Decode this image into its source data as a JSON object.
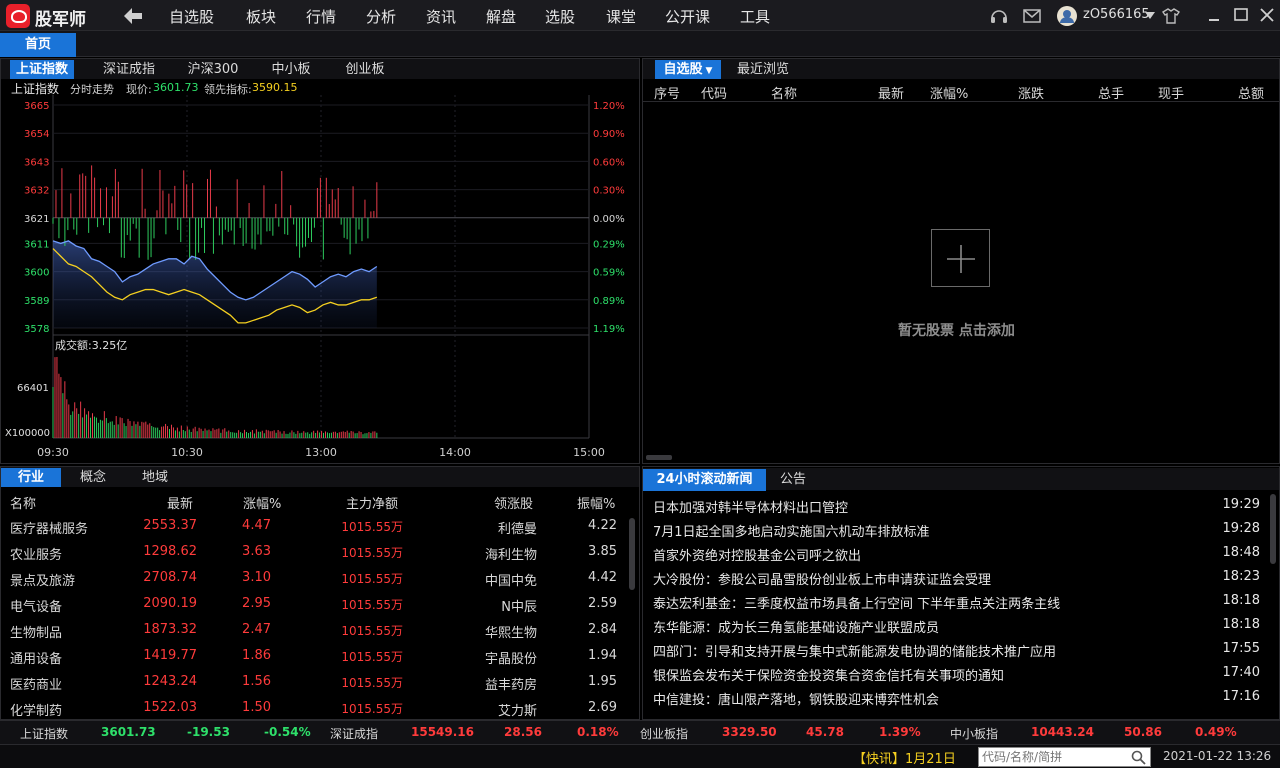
{
  "app": {
    "name": "股军师",
    "menu": [
      "自选股",
      "板块",
      "行情",
      "分析",
      "资讯",
      "解盘",
      "选股",
      "课堂",
      "公开课",
      "工具"
    ],
    "user": "zO566165",
    "home_tab": "首页"
  },
  "index_panel": {
    "tabs": [
      "上证指数",
      "深证成指",
      "沪深300",
      "中小板",
      "创业板"
    ],
    "header": {
      "name": "上证指数",
      "mode": "分时走势",
      "price_label": "现价:",
      "price": "3601.73",
      "lead_label": "领先指标:",
      "lead": "3590.15"
    },
    "volume_label": "成交额:3.25亿",
    "volume_ticks": [
      "66401",
      "X100000"
    ]
  },
  "chart_data": {
    "type": "line",
    "title": "",
    "y_ticks": [
      "3665",
      "3654",
      "3643",
      "3632",
      "3621",
      "3611",
      "3600",
      "3589",
      "3578"
    ],
    "pct_ticks": [
      "1.20%",
      "0.90%",
      "0.60%",
      "0.30%",
      "0.00%",
      "0.29%",
      "0.59%",
      "0.89%",
      "1.19%"
    ],
    "x_ticks": [
      "09:30",
      "10:30",
      "13:00",
      "14:00",
      "15:00"
    ],
    "ylim": [
      3578,
      3665
    ],
    "prev_close": 3621,
    "series": [
      {
        "values": [
          3612,
          3611,
          3612,
          3610,
          3609,
          3605,
          3604,
          3602,
          3600,
          3596,
          3598,
          3599,
          3601,
          3603,
          3604,
          3605,
          3605,
          3603,
          3606,
          3605,
          3601,
          3598,
          3595,
          3592,
          3590,
          3589,
          3590,
          3592,
          3594,
          3596,
          3598,
          3600,
          3599,
          3597,
          3594,
          3596,
          3598,
          3599,
          3598,
          3600,
          3601,
          3600,
          3602
        ]
      },
      {
        "values": [
          3609,
          3606,
          3603,
          3602,
          3600,
          3598,
          3595,
          3592,
          3590,
          3589,
          3591,
          3592,
          3593,
          3593,
          3592,
          3591,
          3592,
          3593,
          3592,
          3591,
          3589,
          3587,
          3585,
          3583,
          3580,
          3580,
          3581,
          3582,
          3583,
          3585,
          3586,
          3587,
          3586,
          3584,
          3585,
          3587,
          3588,
          3587,
          3587,
          3588,
          3589,
          3589,
          3590
        ]
      }
    ]
  },
  "sector_panel": {
    "tabs": [
      "行业",
      "概念",
      "地域"
    ],
    "columns": [
      "名称",
      "最新",
      "涨幅%",
      "主力净额",
      "领涨股",
      "振幅%"
    ],
    "rows": [
      [
        "医疗器械服务",
        "2553.37",
        "4.47",
        "1015.55万",
        "利德曼",
        "4.22"
      ],
      [
        "农业服务",
        "1298.62",
        "3.63",
        "1015.55万",
        "海利生物",
        "3.85"
      ],
      [
        "景点及旅游",
        "2708.74",
        "3.10",
        "1015.55万",
        "中国中免",
        "4.42"
      ],
      [
        "电气设备",
        "2090.19",
        "2.95",
        "1015.55万",
        "N中辰",
        "2.59"
      ],
      [
        "生物制品",
        "1873.32",
        "2.47",
        "1015.55万",
        "华熙生物",
        "2.84"
      ],
      [
        "通用设备",
        "1419.77",
        "1.86",
        "1015.55万",
        "宇晶股份",
        "1.94"
      ],
      [
        "医药商业",
        "1243.24",
        "1.56",
        "1015.55万",
        "益丰药房",
        "1.95"
      ],
      [
        "化学制药",
        "1522.03",
        "1.50",
        "1015.55万",
        "艾力斯",
        "2.69"
      ]
    ]
  },
  "watch_panel": {
    "tabs": [
      "自选股",
      "最近浏览"
    ],
    "columns": [
      "序号",
      "代码",
      "名称",
      "最新",
      "涨幅%",
      "涨跌",
      "总手",
      "现手",
      "总额"
    ],
    "empty_text": "暂无股票 点击添加"
  },
  "news_panel": {
    "tabs": [
      "24小时滚动新闻",
      "公告"
    ],
    "items": [
      {
        "title": "日本加强对韩半导体材料出口管控",
        "time": "19:29"
      },
      {
        "title": "7月1日起全国多地启动实施国六机动车排放标准",
        "time": "19:28"
      },
      {
        "title": "首家外资绝对控股基金公司呼之欲出",
        "time": "18:48"
      },
      {
        "title": "大冷股份：参股公司晶雪股份创业板上市申请获证监会受理",
        "time": "18:23"
      },
      {
        "title": "泰达宏利基金：三季度权益市场具备上行空间 下半年重点关注两条主线",
        "time": "18:18"
      },
      {
        "title": "东华能源：成为长三角氢能基础设施产业联盟成员",
        "time": "18:18"
      },
      {
        "title": "四部门：引导和支持开展与集中式新能源发电协调的储能技术推广应用",
        "time": "17:55"
      },
      {
        "title": "银保监会发布关于保险资金投资集合资金信托有关事项的通知",
        "time": "17:40"
      },
      {
        "title": "中信建投：唐山限产落地，钢铁股迎来博弈性机会",
        "time": "17:16"
      }
    ]
  },
  "status": {
    "indices": [
      {
        "name": "上证指数",
        "value": "3601.73",
        "change": "-19.53",
        "pct": "-0.54%"
      },
      {
        "name": "深证成指",
        "value": "15549.16",
        "change": "28.56",
        "pct": "0.18%"
      },
      {
        "name": "创业板指",
        "value": "3329.50",
        "change": "45.78",
        "pct": "1.39%"
      },
      {
        "name": "中小板指",
        "value": "10443.24",
        "change": "50.86",
        "pct": "0.49%"
      }
    ],
    "flash": "【快讯】1月21日",
    "search_placeholder": "代码/名称/简拼",
    "datetime": "2021-01-22 13:26"
  },
  "colors": {
    "accent": "#1a74d8",
    "up": "#ff3b3b",
    "down": "#2ee06a",
    "price_line": "#6f9bff",
    "avg_line": "#f5d020"
  },
  "icons": [
    "logo-icon",
    "back-arrow-icon",
    "headset-icon",
    "mail-icon",
    "avatar-icon",
    "skin-icon",
    "minimize-icon",
    "maximize-icon",
    "close-icon",
    "search-icon",
    "plus-icon"
  ]
}
